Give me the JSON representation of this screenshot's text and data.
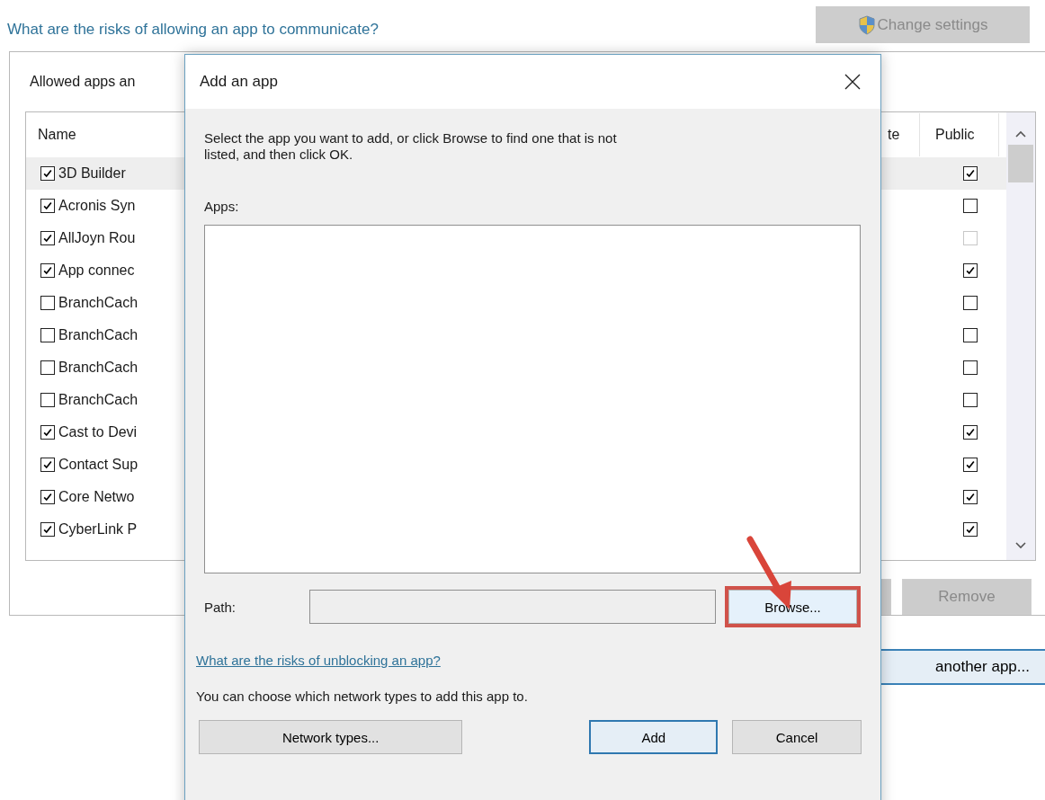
{
  "background": {
    "link": "What are the risks of allowing an app to communicate?",
    "change_settings": {
      "label": "Change settings",
      "disabled": true
    },
    "panel_heading": "Allowed apps an",
    "table": {
      "columns": [
        "Name",
        "te",
        "Public"
      ],
      "rows": [
        {
          "name": "3D Builder",
          "checked": true,
          "selected": true,
          "public": {
            "checked": true,
            "disabled": false
          }
        },
        {
          "name": "Acronis Syn",
          "checked": true,
          "selected": false,
          "public": {
            "checked": false,
            "disabled": false
          }
        },
        {
          "name": "AllJoyn Rou",
          "checked": true,
          "selected": false,
          "public": {
            "checked": false,
            "disabled": true
          }
        },
        {
          "name": "App connec",
          "checked": true,
          "selected": false,
          "public": {
            "checked": true,
            "disabled": false
          }
        },
        {
          "name": "BranchCach",
          "checked": false,
          "selected": false,
          "public": {
            "checked": false,
            "disabled": false
          }
        },
        {
          "name": "BranchCach",
          "checked": false,
          "selected": false,
          "public": {
            "checked": false,
            "disabled": false
          }
        },
        {
          "name": "BranchCach",
          "checked": false,
          "selected": false,
          "public": {
            "checked": false,
            "disabled": false
          }
        },
        {
          "name": "BranchCach",
          "checked": false,
          "selected": false,
          "public": {
            "checked": false,
            "disabled": false
          }
        },
        {
          "name": "Cast to Devi",
          "checked": true,
          "selected": false,
          "public": {
            "checked": true,
            "disabled": false
          }
        },
        {
          "name": "Contact Sup",
          "checked": true,
          "selected": false,
          "public": {
            "checked": true,
            "disabled": false
          }
        },
        {
          "name": "Core Netwo",
          "checked": true,
          "selected": false,
          "public": {
            "checked": true,
            "disabled": false
          }
        },
        {
          "name": "CyberLink P",
          "checked": true,
          "selected": false,
          "public": {
            "checked": true,
            "disabled": false
          }
        }
      ]
    },
    "remove_button": {
      "label": "Remove",
      "disabled": true
    },
    "allow_button": {
      "label": "another app..."
    }
  },
  "dialog": {
    "title": "Add an app",
    "description": "Select the app you want to add, or click Browse to find one that is not listed, and then click OK.",
    "apps_label": "Apps:",
    "path_label": "Path:",
    "browse_button": {
      "label": "Browse...",
      "highlighted": true
    },
    "risks_link": "What are the risks of unblocking an app?",
    "note": "You can choose which network types to add this app to.",
    "buttons": [
      {
        "label": "Network types...",
        "default": false
      },
      {
        "label": "Add",
        "default": true
      },
      {
        "label": "Cancel",
        "default": false
      }
    ]
  }
}
